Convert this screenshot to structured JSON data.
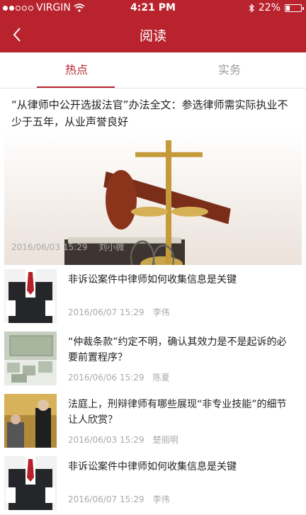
{
  "status": {
    "carrier": "VIRGIN",
    "time": "4:21 PM",
    "battery": "22%",
    "battery_level": 0.22
  },
  "header": {
    "title": "阅读"
  },
  "tabs": [
    {
      "label": "热点",
      "active": true
    },
    {
      "label": "实务",
      "active": false
    }
  ],
  "featured": {
    "title": "“从律师中公开选拔法官”办法全文：参选律师需实际执业不少于五年，从业声誉良好",
    "date": "2016/06/03 15:29",
    "author": "刘小微"
  },
  "articles": [
    {
      "title": "非诉讼案件中律师如何收集信息是关键",
      "date": "2016/06/07 15:29",
      "author": "李伟"
    },
    {
      "title": "“仲裁条款”约定不明，确认其效力是不是起诉的必要前置程序？",
      "date": "2016/06/06 15:29",
      "author": "陈夏"
    },
    {
      "title": "法庭上，刑辩律师有哪些展现“非专业技能”的细节让人欣赏？",
      "date": "2016/06/03 15:29",
      "author": "楚丽明"
    },
    {
      "title": "非诉讼案件中律师如何收集信息是关键",
      "date": "2016/06/07 15:29",
      "author": "李伟"
    }
  ],
  "colors": {
    "brand": "#b8232e",
    "meta": "#aaaaaa"
  }
}
